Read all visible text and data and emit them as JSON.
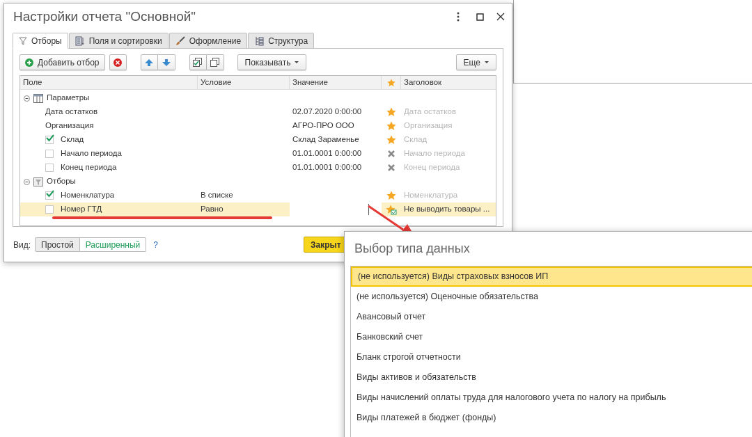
{
  "window": {
    "title": "Настройки отчета \"Основной\""
  },
  "tabs": [
    {
      "label": "Отборы",
      "selected": true,
      "kind": "filter"
    },
    {
      "label": "Поля и сортировки",
      "selected": false,
      "kind": "fields"
    },
    {
      "label": "Оформление",
      "selected": false,
      "kind": "brush"
    },
    {
      "label": "Структура",
      "selected": false,
      "kind": "structure"
    }
  ],
  "toolbar": {
    "add_label": "Добавить отбор",
    "show_label": "Показывать",
    "more_label": "Еще"
  },
  "table": {
    "columns": [
      "Поле",
      "Условие",
      "Значение",
      "Заголовок"
    ],
    "groups": [
      {
        "label": "Параметры",
        "kind": "parameters",
        "expanded": true,
        "children": [
          {
            "field": "Дата остатков",
            "value": "02.07.2020 0:00:00",
            "kind": "star",
            "heading": "Дата остатков",
            "heading_custom": false,
            "selected": false
          },
          {
            "field": "Организация",
            "value": "АГРО-ПРО ООО",
            "kind": "star",
            "heading": "Организация",
            "heading_custom": false,
            "selected": false
          },
          {
            "field": "Склад",
            "checked": true,
            "value": "Склад Зараменье",
            "kind": "star",
            "heading": "Склад",
            "heading_custom": false,
            "selected": false
          },
          {
            "field": "Начало периода",
            "checked": false,
            "value": "01.01.0001 0:00:00",
            "kind": "cross",
            "heading": "Начало периода",
            "heading_custom": false,
            "selected": false
          },
          {
            "field": "Конец периода",
            "checked": false,
            "value": "01.01.0001 0:00:00",
            "kind": "cross",
            "heading": "Конец периода",
            "heading_custom": false,
            "selected": false
          }
        ]
      },
      {
        "label": "Отборы",
        "kind": "filters",
        "expanded": true,
        "children": [
          {
            "field": "Номенклатура",
            "checked": true,
            "condition": "В списке",
            "kind": "star",
            "heading": "Номенклатура",
            "heading_custom": false,
            "selected": false
          },
          {
            "field": "Номер ГТД",
            "checked": false,
            "condition": "Равно",
            "kind": "star-check",
            "heading": "Не выводить товары ...",
            "heading_custom": true,
            "selected": true
          }
        ]
      }
    ]
  },
  "view": {
    "label": "Вид:",
    "options": [
      {
        "label": "Простой",
        "selected": false
      },
      {
        "label": "Расширенный",
        "selected": true
      }
    ],
    "help": "?"
  },
  "close_label": "Закрыт",
  "popup": {
    "title": "Выбор типа данных",
    "items": [
      {
        "label": "(не используется) Виды страховых взносов ИП",
        "selected": true
      },
      {
        "label": "(не используется) Оценочные обязательства",
        "selected": false
      },
      {
        "label": "Авансовый отчет",
        "selected": false
      },
      {
        "label": "Банковский счет",
        "selected": false
      },
      {
        "label": "Бланк строгой отчетности",
        "selected": false
      },
      {
        "label": "Виды активов и обязательств",
        "selected": false
      },
      {
        "label": "Виды начислений оплаты труда для налогового учета по налогу на прибыль",
        "selected": false
      },
      {
        "label": "Виды платежей в бюджет (фонды)",
        "selected": false
      }
    ]
  }
}
